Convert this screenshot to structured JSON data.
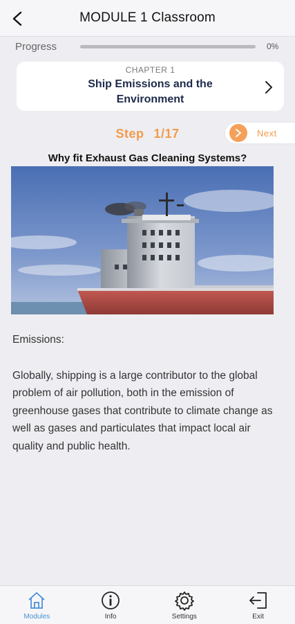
{
  "header": {
    "title": "MODULE 1 Classroom",
    "back_icon": "chevron-left-icon"
  },
  "progress": {
    "label": "Progress",
    "percent_text": "0%",
    "value": 0
  },
  "chapter": {
    "kicker": "CHAPTER 1",
    "title": "Ship Emissions and the Environment",
    "chevron_icon": "chevron-right-icon"
  },
  "step": {
    "word": "Step",
    "counter": "1/17"
  },
  "next_button": {
    "label": "Next",
    "icon": "chevron-right-icon"
  },
  "content": {
    "question": "Why fit Exhaust Gas Cleaning Systems?",
    "image_subject": "ship-superstructure-with-smoking-funnel",
    "heading": "Emissions:",
    "paragraph": "Globally, shipping is a large contributor to the global problem of air pollution, both in the emission of greenhouse gases that contribute to climate change as well as gases and particulates that impact local air quality and public health."
  },
  "bottom_nav": [
    {
      "label": "Modules",
      "icon": "home-icon",
      "active": true
    },
    {
      "label": "Info",
      "icon": "info-icon",
      "active": false
    },
    {
      "label": "Settings",
      "icon": "gear-icon",
      "active": false
    },
    {
      "label": "Exit",
      "icon": "exit-icon",
      "active": false
    }
  ],
  "colors": {
    "accent": "#f39a4a",
    "active_nav": "#4a8fd6",
    "background": "#eeeef2"
  }
}
